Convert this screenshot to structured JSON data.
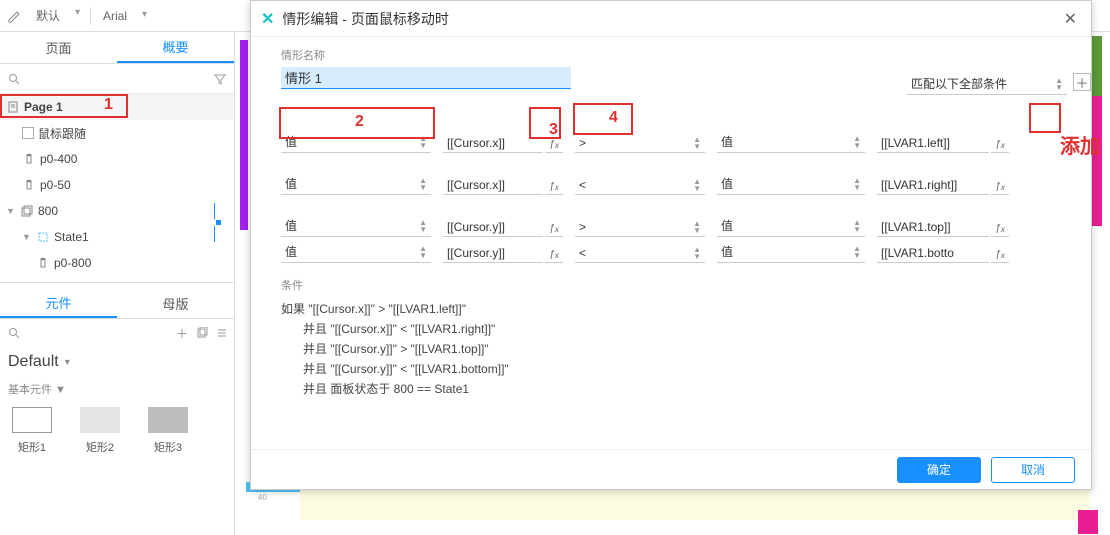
{
  "toolbar": {
    "preset": "默认",
    "font": "Arial"
  },
  "left": {
    "tabs": {
      "pages": "页面",
      "summary": "概要"
    },
    "search_placeholder": "",
    "outline": {
      "page1": "Page 1",
      "mouse_follow": "鼠标跟随",
      "p0_400": "p0-400",
      "p0_50": "p0-50",
      "g800": "800",
      "state1": "State1",
      "p0_800": "p0-800"
    },
    "tabs2": {
      "components": "元件",
      "masters": "母版"
    },
    "lib_name": "Default",
    "lib_sub": "基本元件 ▼",
    "shapes": {
      "r1": "矩形1",
      "r2": "矩形2",
      "r3": "矩形3"
    }
  },
  "dialog": {
    "title": "情形编辑  -  页面鼠标移动时",
    "case_section_label": "情形名称",
    "case_name": "情形 1",
    "match_label": "匹配以下全部条件",
    "rows": [
      {
        "a": "值",
        "b": "[[Cursor.x]]",
        "op": ">",
        "c": "值",
        "d": "[[LVAR1.left]]"
      },
      {
        "a": "值",
        "b": "[[Cursor.x]]",
        "op": "<",
        "c": "值",
        "d": "[[LVAR1.right]]"
      },
      {
        "a": "值",
        "b": "[[Cursor.y]]",
        "op": ">",
        "c": "值",
        "d": "[[LVAR1.top]]"
      },
      {
        "a": "值",
        "b": "[[Cursor.y]]",
        "op": "<",
        "c": "值",
        "d": "[[LVAR1.botto"
      }
    ],
    "summary_label": "条件",
    "summary": [
      "如果 \"[[Cursor.x]]\" > \"[[LVAR1.left]]\"",
      "并且 \"[[Cursor.x]]\" < \"[[LVAR1.right]]\"",
      "并且 \"[[Cursor.y]]\" > \"[[LVAR1.top]]\"",
      "并且 \"[[Cursor.y]]\" < \"[[LVAR1.bottom]]\"",
      "并且  面板状态于 800 == State1"
    ],
    "ok": "确定",
    "cancel": "取消"
  },
  "ann": {
    "n1": "1",
    "n2": "2",
    "n3": "3",
    "n4": "4",
    "add": "添加"
  },
  "ruler_40": "40"
}
